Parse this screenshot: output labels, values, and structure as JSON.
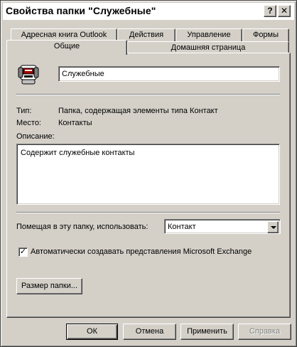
{
  "window": {
    "title": "Свойства папки \"Служебные\"",
    "help_glyph": "?",
    "close_glyph": "✕"
  },
  "tabs": {
    "row_back": [
      "Адресная книга Outlook",
      "Действия",
      "Управление",
      "Формы"
    ],
    "row_front": [
      "Общие",
      "Домашняя страница"
    ],
    "active": "Общие"
  },
  "general": {
    "folder_icon": "contact-folder-icon",
    "folder_name": "Служебные",
    "type_label": "Тип:",
    "type_value": "Папка, содержащая элементы типа Контакт",
    "location_label": "Место:",
    "location_value": "Контакты",
    "description_label": "Описание:",
    "description_value": "Содержит служебные контакты",
    "post_label": "Помещая в эту папку, использовать:",
    "post_value": "Контакт",
    "exchange_checkbox_label": "Автоматически создавать представления Microsoft Exchange",
    "exchange_checked": true,
    "folder_size_button": "Размер папки..."
  },
  "footer": {
    "ok": "ОК",
    "cancel": "Отмена",
    "apply": "Применить",
    "help": "Справка"
  }
}
